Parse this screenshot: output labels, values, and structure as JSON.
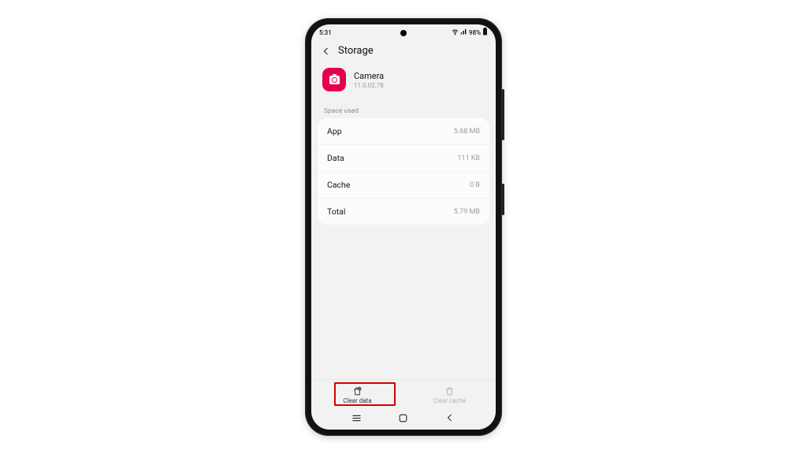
{
  "statusbar": {
    "time": "5:31",
    "battery_pct": "98%"
  },
  "header": {
    "title": "Storage"
  },
  "app": {
    "name": "Camera",
    "version": "11.0.02.78"
  },
  "section_label": "Space used",
  "rows": [
    {
      "label": "App",
      "value": "5.68 MB"
    },
    {
      "label": "Data",
      "value": "111 KB"
    },
    {
      "label": "Cache",
      "value": "0 B"
    },
    {
      "label": "Total",
      "value": "5.79 MB"
    }
  ],
  "actions": {
    "clear_data": "Clear data",
    "clear_cache": "Clear cache"
  },
  "colors": {
    "accent": "#e6004c",
    "highlight": "#d60000"
  }
}
